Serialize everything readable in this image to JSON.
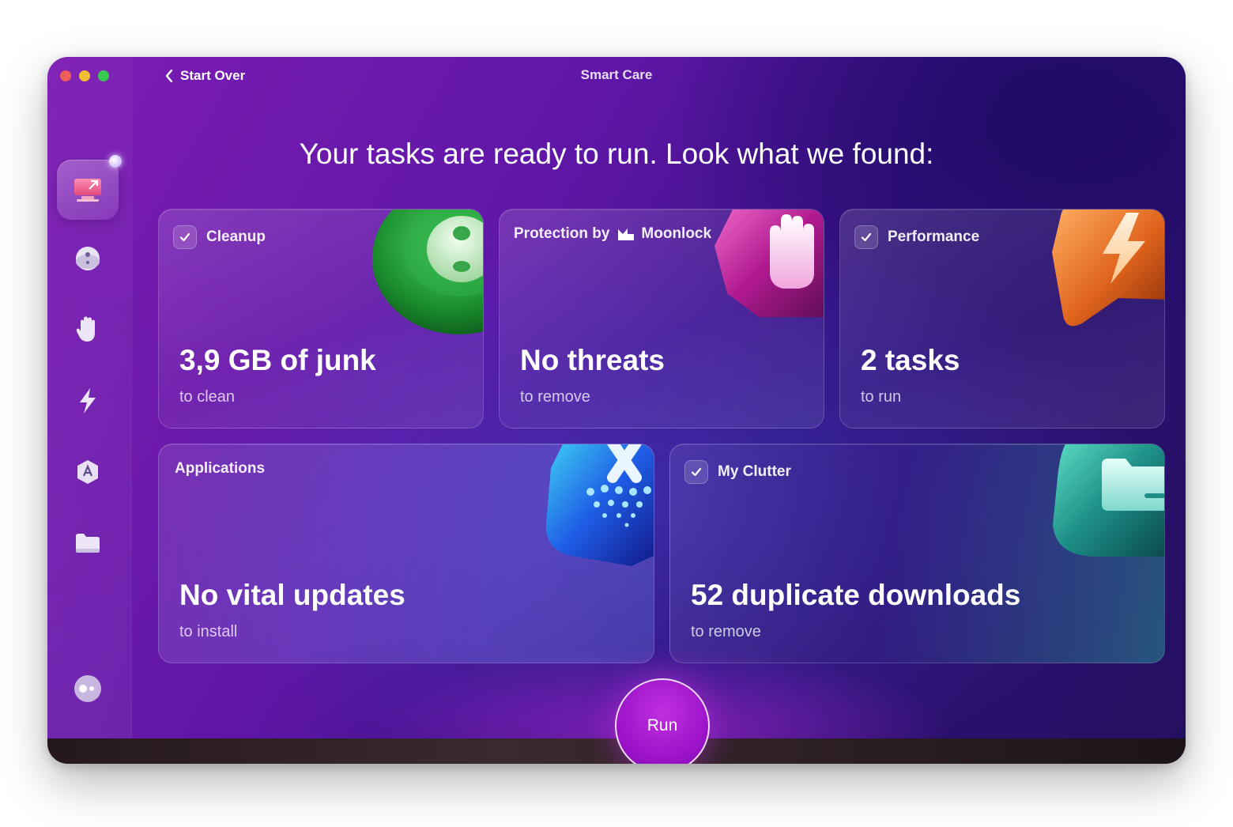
{
  "window": {
    "title": "Smart Care",
    "back_label": "Start Over"
  },
  "headline": "Your tasks are ready to run. Look what we found:",
  "sidebar": {
    "items": [
      {
        "name": "smart-care-icon",
        "active": true
      },
      {
        "name": "cleanup-icon"
      },
      {
        "name": "protection-icon"
      },
      {
        "name": "performance-icon"
      },
      {
        "name": "applications-icon"
      },
      {
        "name": "files-icon"
      },
      {
        "name": "assistant-icon"
      }
    ]
  },
  "cards": {
    "cleanup": {
      "title": "Cleanup",
      "checked": true,
      "main": "3,9 GB of junk",
      "sub": "to clean"
    },
    "protection": {
      "title_prefix": "Protection by",
      "brand": "Moonlock",
      "main": "No threats",
      "sub": "to remove"
    },
    "performance": {
      "title": "Performance",
      "checked": true,
      "main": "2 tasks",
      "sub": "to run"
    },
    "applications": {
      "title": "Applications",
      "main": "No vital updates",
      "sub": "to install"
    },
    "clutter": {
      "title": "My Clutter",
      "checked": true,
      "main": "52 duplicate downloads",
      "sub": "to remove"
    }
  },
  "run_button": {
    "label": "Run"
  },
  "colors": {
    "accent": "#a11ad0",
    "window_bg_start": "#7d1cb4",
    "window_bg_end": "#24105f"
  }
}
